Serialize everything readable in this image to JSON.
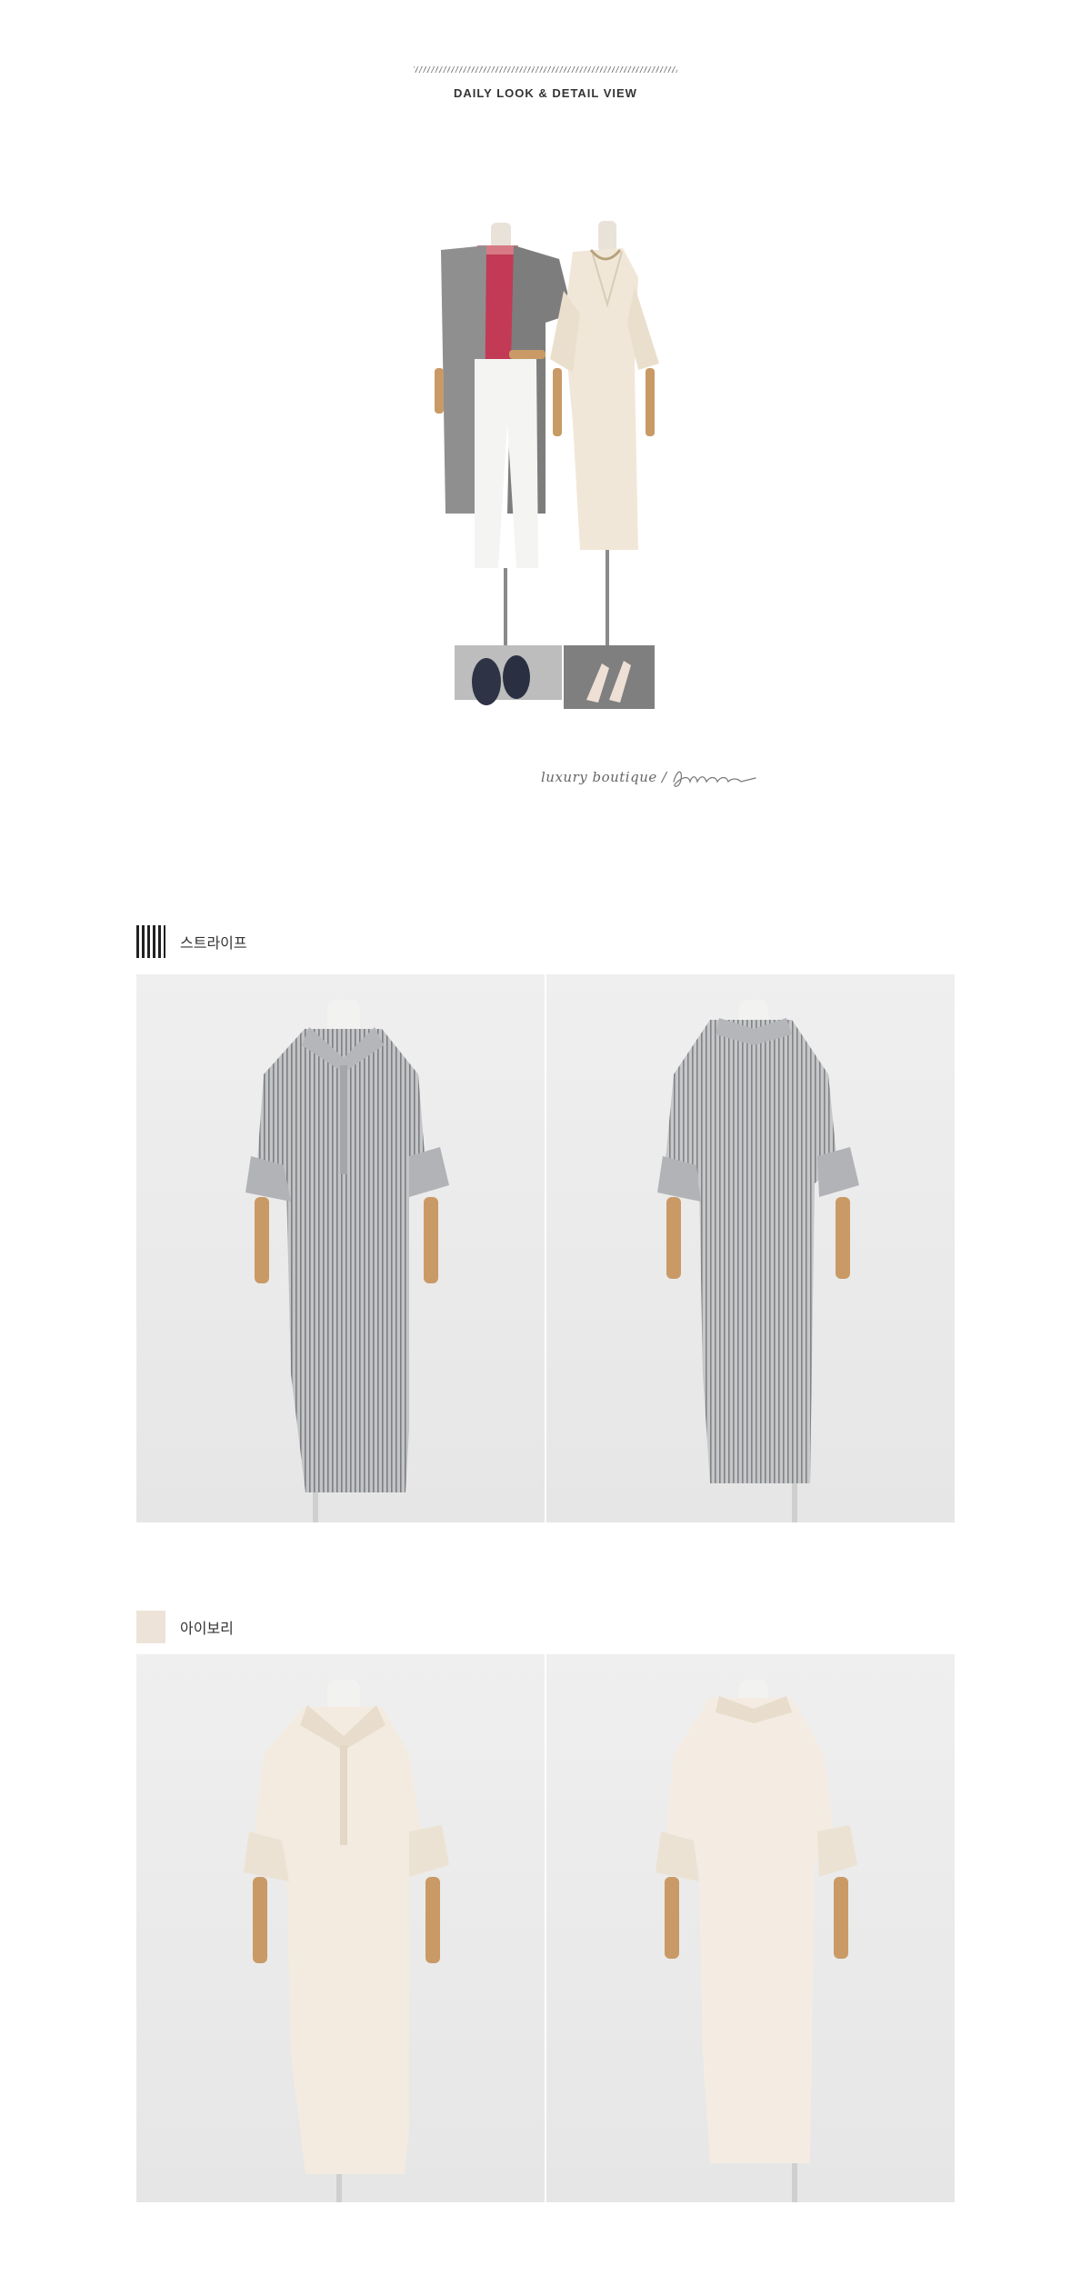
{
  "header": {
    "title": "DAILY LOOK & DETAIL VIEW"
  },
  "hero": {
    "tagline": "luxury boutique  /",
    "signature": "Jblanc"
  },
  "colors": [
    {
      "name": "스트라이프",
      "swatch": "stripe",
      "swatch_color": "#222222"
    },
    {
      "name": "아이보리",
      "swatch": "solid",
      "swatch_color": "#eee3d8"
    }
  ],
  "palette": {
    "stripe_fabric": "#a9abad",
    "ivory_fabric": "#f1e9de",
    "background": "#e9e9e9",
    "mannequin_arm": "#c9a071"
  }
}
